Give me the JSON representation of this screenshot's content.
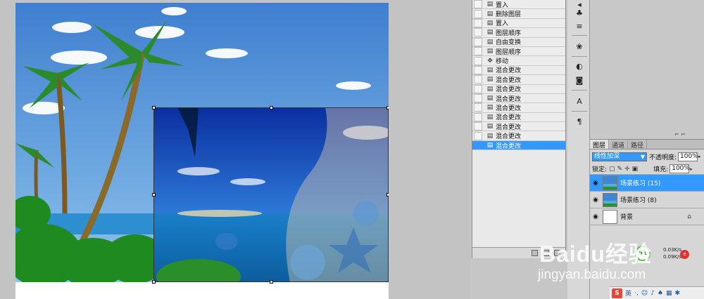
{
  "history": {
    "items": [
      {
        "label": "置入",
        "icon": "layer-icon"
      },
      {
        "label": "删除图层",
        "icon": "layer-icon"
      },
      {
        "label": "置入",
        "icon": "layer-icon"
      },
      {
        "label": "图层顺序",
        "icon": "layer-icon"
      },
      {
        "label": "自由变换",
        "icon": "layer-icon"
      },
      {
        "label": "图层顺序",
        "icon": "layer-icon"
      },
      {
        "label": "移动",
        "icon": "move-icon"
      },
      {
        "label": "混合更改",
        "icon": "layer-icon"
      },
      {
        "label": "混合更改",
        "icon": "layer-icon"
      },
      {
        "label": "混合更改",
        "icon": "layer-icon"
      },
      {
        "label": "混合更改",
        "icon": "layer-icon"
      },
      {
        "label": "混合更改",
        "icon": "layer-icon"
      },
      {
        "label": "混合更改",
        "icon": "layer-icon"
      },
      {
        "label": "混合更改",
        "icon": "layer-icon"
      },
      {
        "label": "混合更改",
        "icon": "layer-icon"
      },
      {
        "label": "混合更改",
        "icon": "layer-icon",
        "active": true
      }
    ]
  },
  "layers": {
    "tabs": [
      "图层",
      "通道",
      "路径"
    ],
    "active_tab": "图层",
    "blend_mode": "线性加深",
    "opacity_label": "不透明度:",
    "opacity_value": "100%",
    "lock_label": "锁定:",
    "fill_label": "填充:",
    "fill_value": "100%",
    "items": [
      {
        "name": "场景练习 (15)",
        "active": true
      },
      {
        "name": "场景练习 (8)",
        "active": false
      },
      {
        "name": "背景",
        "active": false,
        "locked": true
      }
    ]
  },
  "status": {
    "net_percent": "51",
    "upload": "0.03K/s",
    "download": "0.09K/s",
    "badge": "e"
  },
  "ime": {
    "logo": "S",
    "mode": "英"
  },
  "watermark": {
    "logo_text": "Baidu经验",
    "url": "jingyan.baidu.com"
  },
  "colors": {
    "selection": "#3399ff",
    "panel": "#d6d6d6",
    "canvas_bg": "#c3c3c3"
  }
}
